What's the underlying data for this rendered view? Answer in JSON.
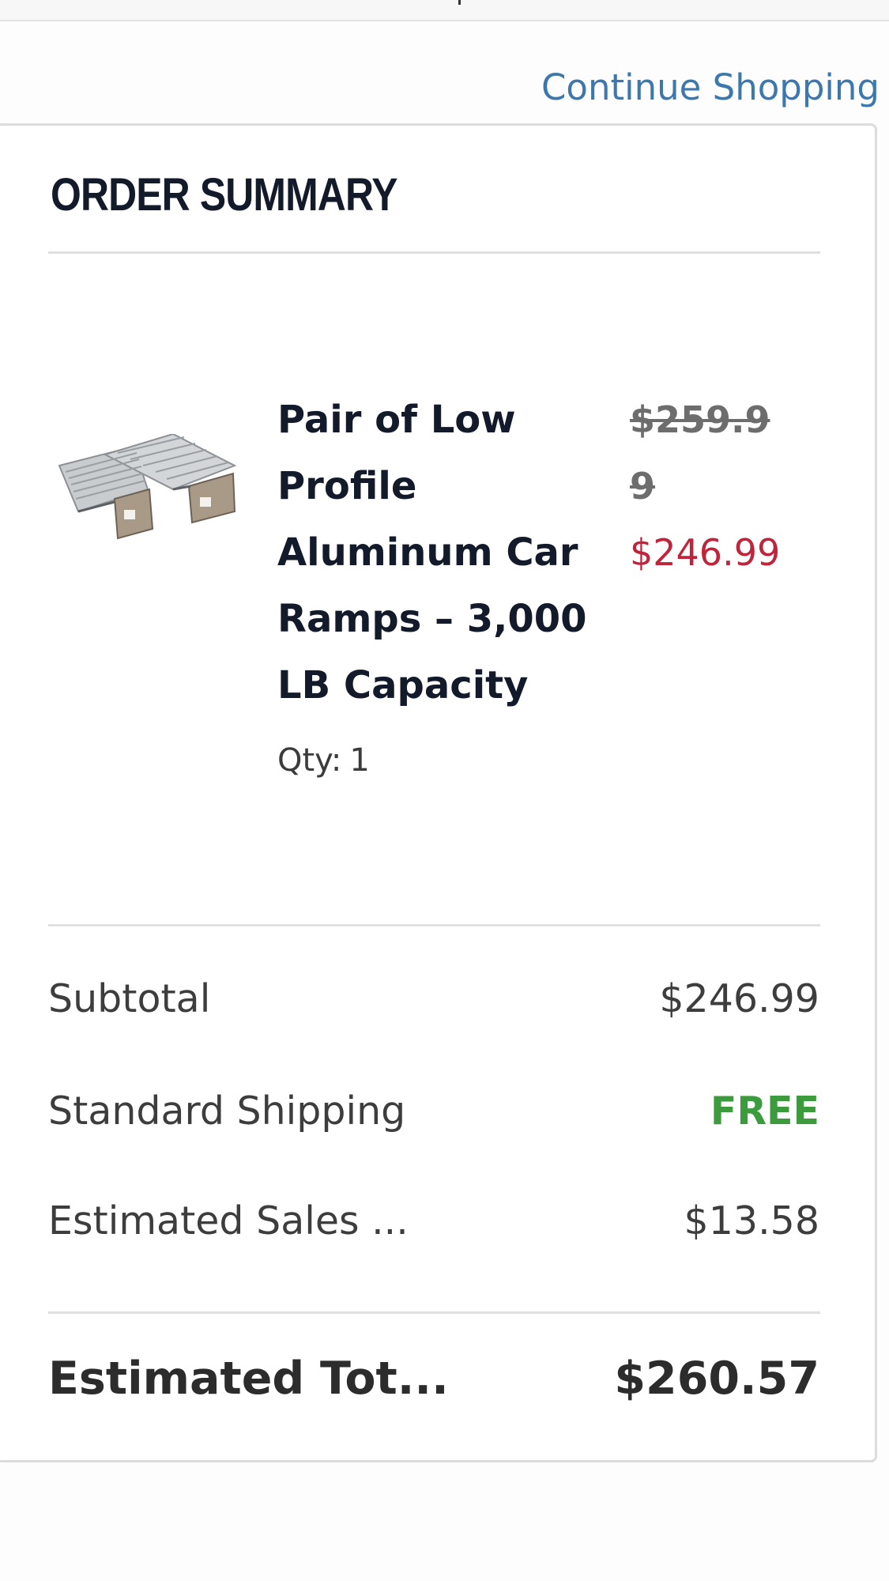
{
  "header": {
    "continue_link": "Continue Shopping"
  },
  "order_summary": {
    "title": "ORDER SUMMARY",
    "item": {
      "image_icon": "car-ramps-product-image",
      "name": "Pair of Low Profile Aluminum Car Ramps – 3,000 LB Capacity",
      "original_price": "$259.99",
      "sale_price": "$246.99",
      "qty_label": "Qty:",
      "qty_value": "1"
    },
    "rows": {
      "subtotal_label": "Subtotal",
      "subtotal_value": "$246.99",
      "shipping_label": "Standard Shipping",
      "shipping_value": "FREE",
      "tax_label": "Estimated Sales ...",
      "tax_value": "$13.58",
      "total_label": "Estimated Tot...",
      "total_value": "$260.57"
    },
    "colors": {
      "link": "#3c77ad",
      "sale_price": "#c0243a",
      "free": "#3c9b3c",
      "title": "#131a2a"
    }
  }
}
